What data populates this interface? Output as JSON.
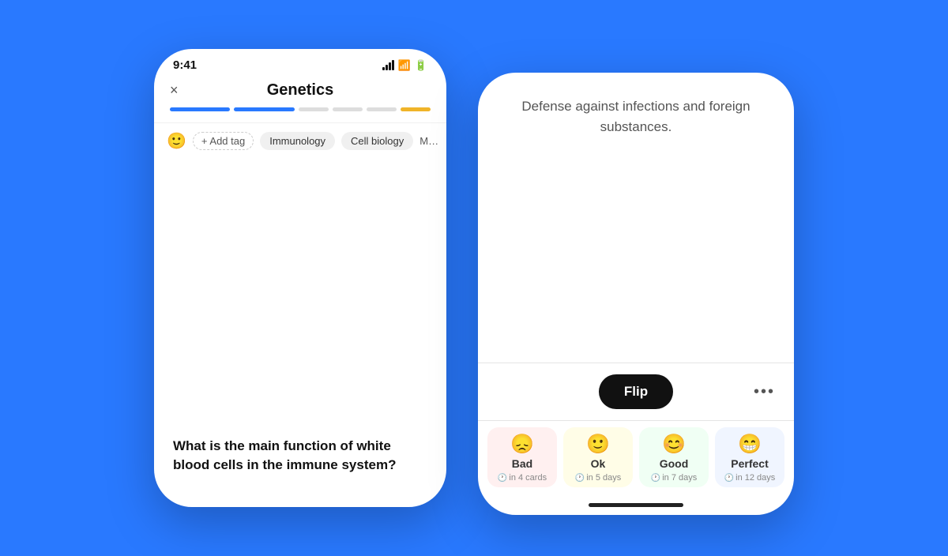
{
  "background_color": "#2979ff",
  "phone_left": {
    "status_time": "9:41",
    "header_title": "Genetics",
    "close_label": "×",
    "progress_segments": [
      {
        "color": "#2979ff",
        "width": "2"
      },
      {
        "color": "#2979ff",
        "width": "2"
      },
      {
        "color": "#ddd",
        "width": "1"
      },
      {
        "color": "#ddd",
        "width": "1"
      },
      {
        "color": "#ddd",
        "width": "1"
      },
      {
        "color": "#f0b429",
        "width": "1"
      }
    ],
    "add_tag_label": "+ Add tag",
    "tags": [
      "Immunology",
      "Cell biology",
      "M…"
    ],
    "question": "What is the main function of white blood cells in the immune system?"
  },
  "phone_right": {
    "answer_text": "Defense against infections and foreign substances.",
    "flip_label": "Flip",
    "more_label": "•••",
    "ratings": [
      {
        "key": "bad",
        "emoji": "😞",
        "label": "Bad",
        "sub": "in 4 cards",
        "bg": "#fff0f0"
      },
      {
        "key": "ok",
        "emoji": "🙂",
        "label": "Ok",
        "sub": "in 5 days",
        "bg": "#fffde7"
      },
      {
        "key": "good",
        "emoji": "😊",
        "label": "Good",
        "sub": "in 7 days",
        "bg": "#f0fff4"
      },
      {
        "key": "perfect",
        "emoji": "😁",
        "label": "Perfect",
        "sub": "in 12 days",
        "bg": "#f0f5ff"
      }
    ]
  }
}
